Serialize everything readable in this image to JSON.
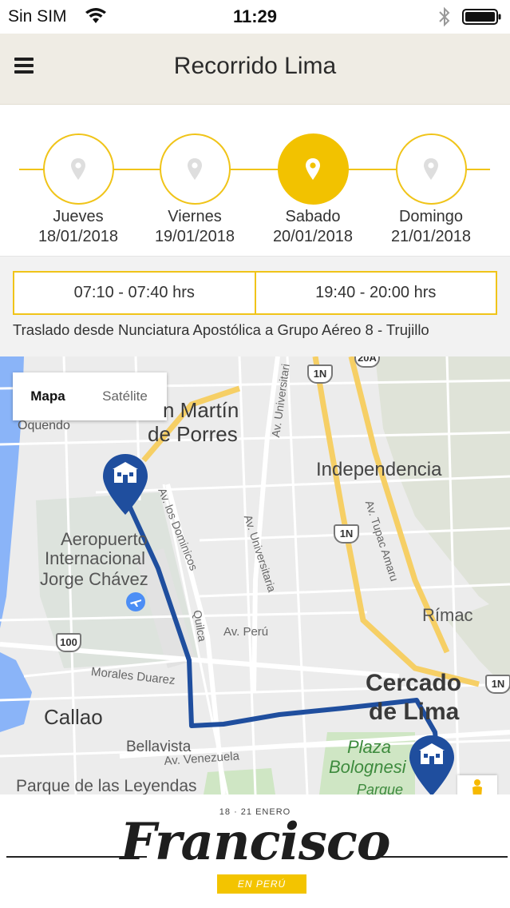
{
  "status_bar": {
    "carrier": "Sin SIM",
    "time": "11:29",
    "icons": [
      "wifi-icon",
      "bluetooth-icon",
      "battery-icon"
    ]
  },
  "nav": {
    "title": "Recorrido Lima",
    "menu_icon": "hamburger-menu-icon"
  },
  "days": [
    {
      "name": "Jueves",
      "date": "18/01/2018",
      "active": false
    },
    {
      "name": "Viernes",
      "date": "19/01/2018",
      "active": false
    },
    {
      "name": "Sabado",
      "date": "20/01/2018",
      "active": true
    },
    {
      "name": "Domingo",
      "date": "21/01/2018",
      "active": false
    }
  ],
  "schedule": {
    "time_1": "07:10 - 07:40 hrs",
    "time_2": "19:40 - 20:00 hrs",
    "description": "Traslado desde Nunciatura Apostólica a Grupo Aéreo 8 - Trujillo"
  },
  "map": {
    "type_map": "Mapa",
    "type_satellite": "Satélite",
    "labels": {
      "san_martin_1": "n Martín",
      "san_martin_2": "de Porres",
      "independencia": "Independencia",
      "oquendo": "Oquendo",
      "aero_1": "Aeropuerto",
      "aero_2": "Internacional",
      "aero_3": "Jorge Chávez",
      "rimac": "Rímac",
      "cercado_1": "Cercado",
      "cercado_2": "de Lima",
      "callao": "Callao",
      "bellavista": "Bellavista",
      "parque": "Parque de las Leyendas",
      "plaza_1": "Plaza",
      "plaza_2": "Bolognesi",
      "parque_2": "Parque",
      "av_universitaria_1": "Av. Universitari",
      "av_universitaria_2": "Av. Universitaria",
      "av_dominicos": "Av. los Dominicos",
      "av_tupac": "Av. Tupac Amaru",
      "quilca": "Quilca",
      "av_peru": "Av. Perú",
      "morales": "Morales Duarez",
      "av_venezuela": "Av. Venezuela",
      "r1n": "1N",
      "r100": "100",
      "r20a": "20A"
    },
    "route_color": "#1f4e9e",
    "marker_icons": [
      "location-marker-icon",
      "location-marker-icon"
    ]
  },
  "footer": {
    "logo_dates": "18 · 21 ENERO",
    "logo_word": "Francisco",
    "logo_badge": "EN PERÚ"
  },
  "colors": {
    "accent": "#f2c200",
    "nav_bg": "#efece4"
  }
}
